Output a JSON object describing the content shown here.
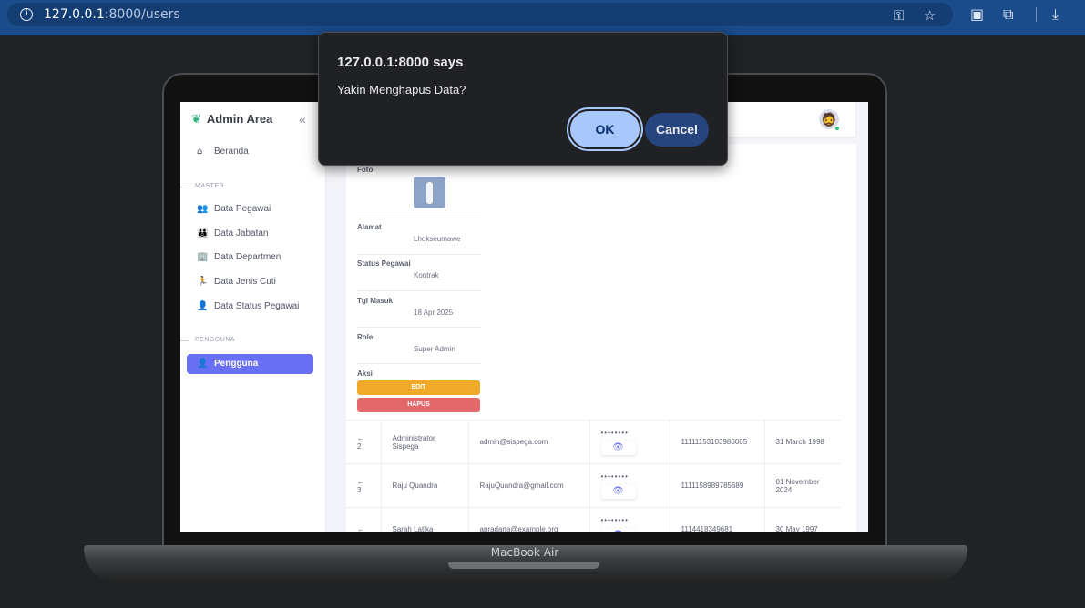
{
  "browser": {
    "url_host": "127.0.0.1",
    "url_path": ":8000/users",
    "icons": [
      "info-icon",
      "key-icon",
      "star-icon",
      "tab-icon",
      "extensions-icon",
      "download-icon"
    ]
  },
  "laptop": {
    "brand": "MacBook Air"
  },
  "sidebar": {
    "app_title": "Admin Area",
    "collapse_icon": "«",
    "items_top": [
      {
        "label": "Beranda",
        "icon": "⌂"
      }
    ],
    "section_master": "MASTER",
    "items_master": [
      {
        "label": "Data Pegawai",
        "icon": "👥"
      },
      {
        "label": "Data Jabatan",
        "icon": "👪"
      },
      {
        "label": "Data Departmen",
        "icon": "🏢"
      },
      {
        "label": "Data Jenis Cuti",
        "icon": "🏃"
      },
      {
        "label": "Data Status Pegawai",
        "icon": "👤"
      }
    ],
    "section_pengguna": "PENGGUNA",
    "items_pengguna": [
      {
        "label": "Pengguna",
        "icon": "👤",
        "active": true
      }
    ]
  },
  "detail": {
    "foto_label": "Foto",
    "alamat_label": "Alamat",
    "alamat_value": "Lhokseumawe",
    "status_label": "Status Pegawai",
    "status_value": "Kontrak",
    "tgl_label": "Tgl Masuk",
    "tgl_value": "18 Apr 2025",
    "role_label": "Role",
    "role_value": "Super Admin",
    "aksi_label": "Aksi",
    "edit_label": "EDIT",
    "hapus_label": "HAPUS"
  },
  "table": {
    "rows": [
      {
        "arrow": "←",
        "no": "2",
        "name": "Administrator Sispega",
        "email": "admin@sispega.com",
        "password": "••••••••",
        "nip": "1111115310398000​5",
        "date": "31 March 1998"
      },
      {
        "arrow": "←",
        "no": "3",
        "name": "Raju Quandra",
        "email": "RajuQuandra@gmail.com",
        "password": "••••••••",
        "nip": "1111158989785689",
        "date": "01 November 2024"
      },
      {
        "arrow": "←",
        "no": "",
        "name": "Sarah Latika",
        "email": "apradana@example.org",
        "password": "••••••••",
        "nip": "1114418349681",
        "date": "30 May 1997"
      }
    ]
  },
  "dialog": {
    "title": "127.0.0.1:8000 says",
    "message": "Yakin Menghapus Data?",
    "ok_label": "OK",
    "cancel_label": "Cancel"
  }
}
